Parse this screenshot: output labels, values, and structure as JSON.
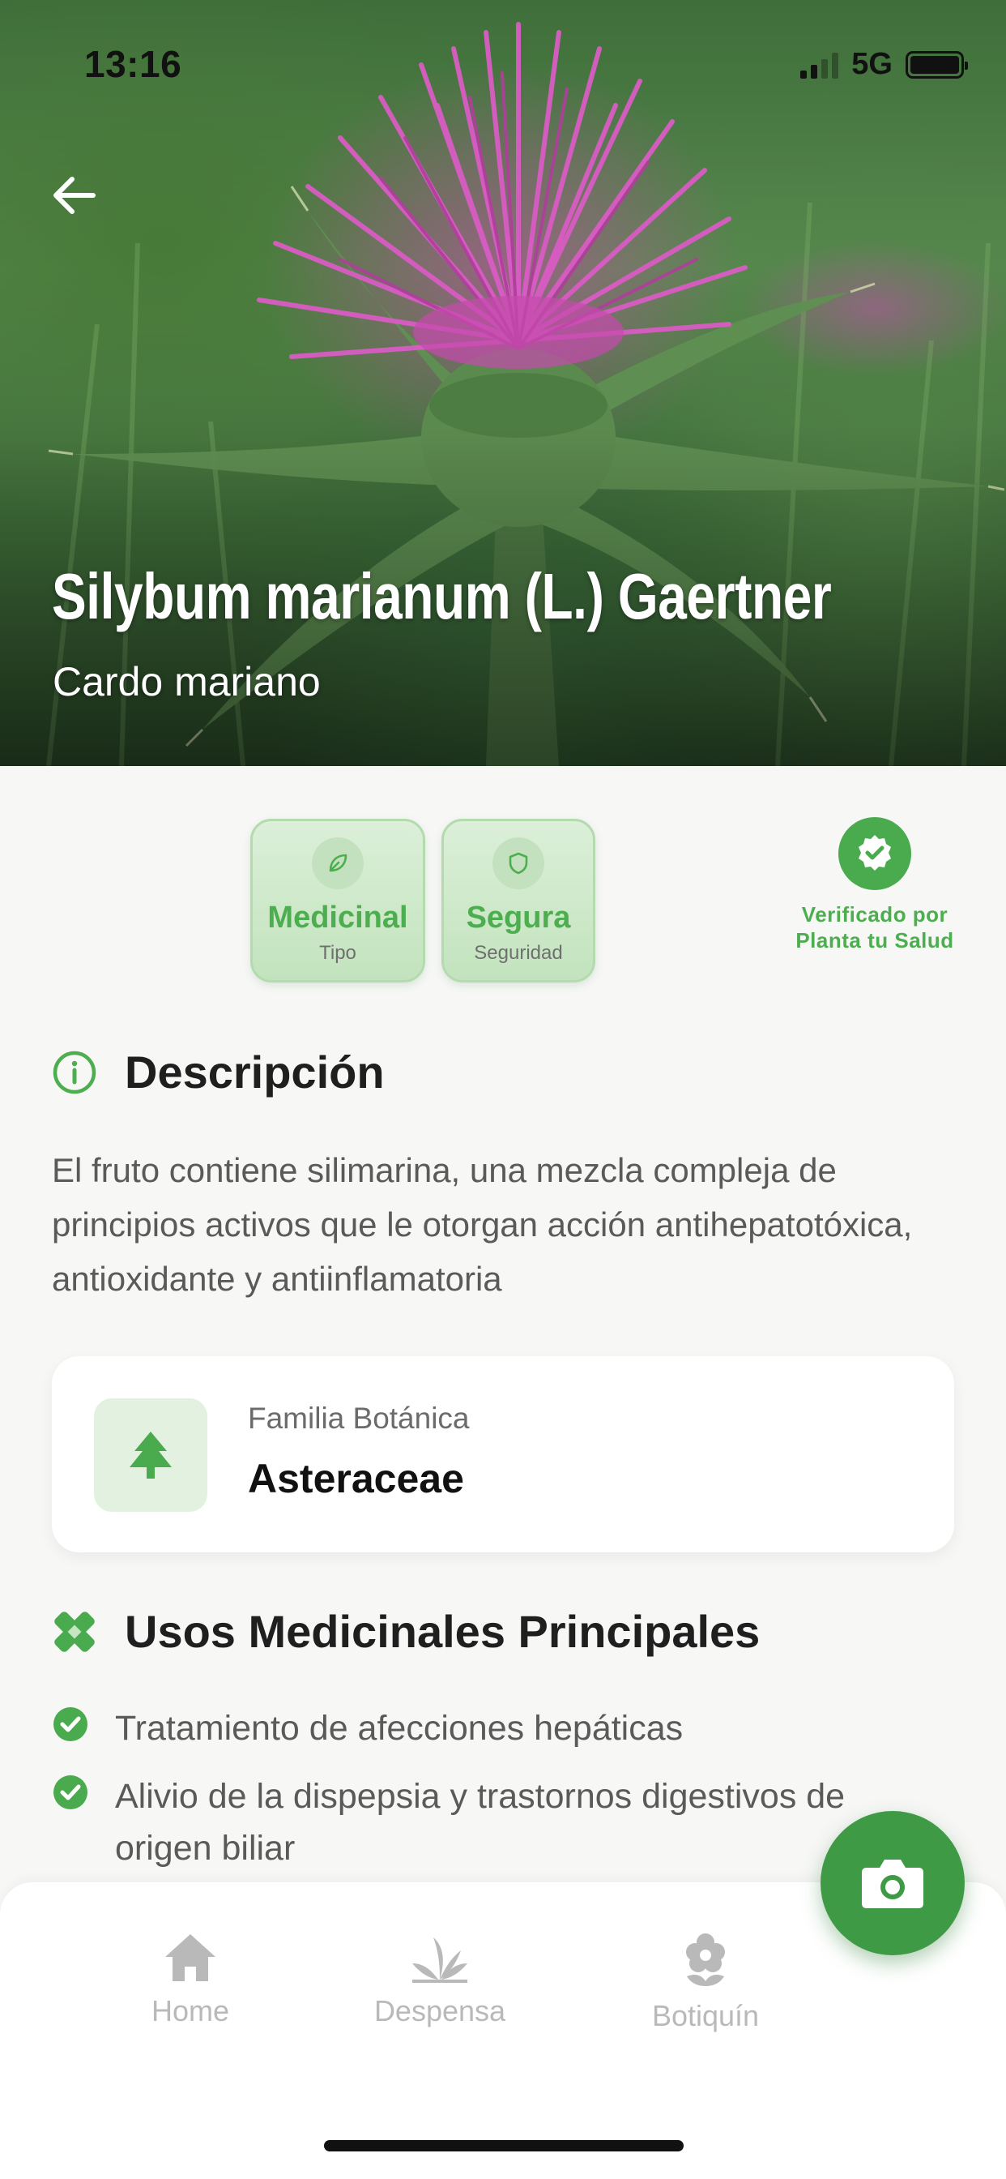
{
  "status_bar": {
    "time": "13:16",
    "network": "5G"
  },
  "hero": {
    "scientific_name": "Silybum marianum (L.) Gaertner",
    "common_name": "Cardo mariano"
  },
  "badges": [
    {
      "value": "Medicinal",
      "caption": "Tipo",
      "icon": "leaf-icon"
    },
    {
      "value": "Segura",
      "caption": "Seguridad",
      "icon": "shield-icon"
    }
  ],
  "verified": {
    "icon": "verified-check-icon",
    "line1": "Verificado por",
    "line2": "Planta tu Salud"
  },
  "description": {
    "title": "Descripción",
    "icon": "info-icon",
    "text": "El fruto contiene silimarina, una mezcla compleja de principios activos que le otorgan acción antihepatotóxica, antioxidante y antiinflamatoria"
  },
  "family": {
    "label": "Familia Botánica",
    "value": "Asteraceae",
    "icon": "tree-icon"
  },
  "uses": {
    "title": "Usos Medicinales Principales",
    "icon": "bandage-icon",
    "items": [
      "Tratamiento de afecciones hepáticas",
      "Alivio de la dispepsia y trastornos digestivos de origen biliar"
    ]
  },
  "nav": {
    "items": [
      {
        "label": "Home",
        "icon": "home-icon"
      },
      {
        "label": "Despensa",
        "icon": "sprout-icon"
      },
      {
        "label": "Botiquín",
        "icon": "flower-icon"
      }
    ],
    "camera_icon": "camera-icon"
  },
  "colors": {
    "accent_green": "#4cae4f",
    "fab_green": "#3e9a44",
    "flower_pink": "#cc4fb5"
  }
}
